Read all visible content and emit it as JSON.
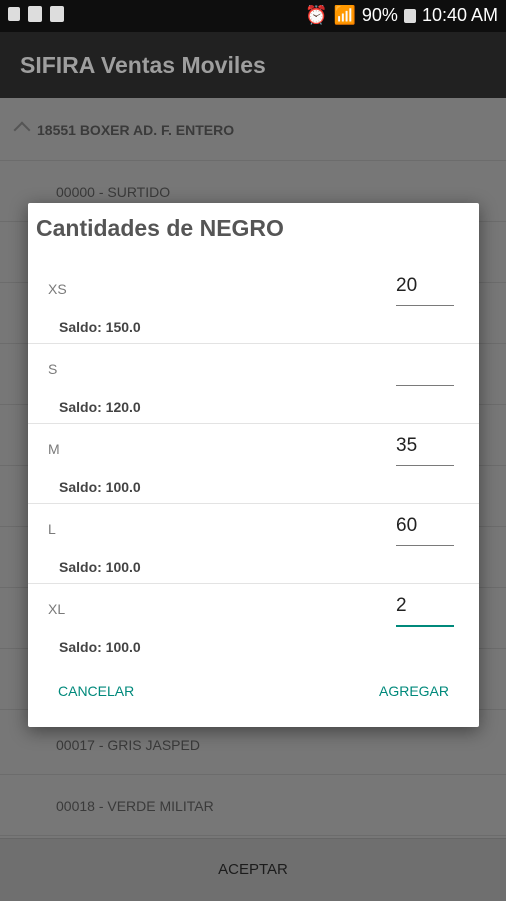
{
  "status_bar": {
    "battery": "90%",
    "time": "10:40 AM"
  },
  "app": {
    "title": "SIFIRA Ventas Moviles"
  },
  "list": {
    "header": "18551 BOXER AD. F. ENTERO",
    "items": [
      "00000 - SURTIDO",
      "",
      "",
      "",
      "",
      "",
      "",
      "",
      "",
      "00017 - GRIS JASPED",
      "00018 - VERDE MILITAR"
    ]
  },
  "bottom": {
    "accept_label": "ACEPTAR"
  },
  "dialog": {
    "title": "Cantidades de NEGRO",
    "sizes": [
      {
        "size": "XS",
        "quantity": "20",
        "saldo": "Saldo: 150.0"
      },
      {
        "size": "S",
        "quantity": "",
        "saldo": "Saldo: 120.0"
      },
      {
        "size": "M",
        "quantity": "35",
        "saldo": "Saldo: 100.0"
      },
      {
        "size": "L",
        "quantity": "60",
        "saldo": "Saldo: 100.0"
      },
      {
        "size": "XL",
        "quantity": "2",
        "saldo": "Saldo: 100.0"
      }
    ],
    "cancel_label": "CANCELAR",
    "add_label": "AGREGAR"
  },
  "colors": {
    "accent": "#00897b",
    "app_bar": "#212121",
    "status_bar": "#0e0e0e"
  }
}
